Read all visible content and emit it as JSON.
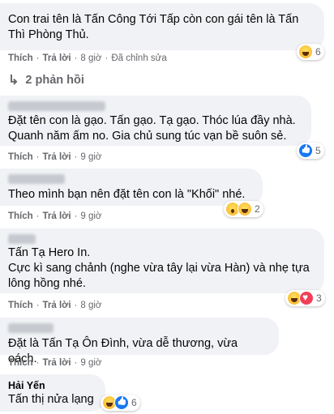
{
  "comments": [
    {
      "name": "",
      "text_lines": [
        "Con trai tên là Tấn Công Tới Tấp còn con gái tên là Tấn",
        "Thì Phòng Thủ."
      ],
      "actions": {
        "like": "Thích",
        "reply": "Trả lời",
        "time": "8 giờ",
        "edited": "Đã chỉnh sửa"
      },
      "reactions": {
        "icons": [
          "haha-icon"
        ],
        "count": "6"
      }
    },
    {
      "name": "",
      "text_lines": [
        "Đặt tên con là gạo. Tấn gạo. Tạ gạo. Thóc lúa đầy nhà.",
        "Quanh năm ấm no. Gia chủ sung túc vạn bề suôn sẻ."
      ],
      "actions": {
        "like": "Thích",
        "reply": "Trả lời",
        "time": "9 giờ"
      },
      "reactions": {
        "icons": [
          "like-icon"
        ],
        "count": "5"
      }
    },
    {
      "name": "",
      "text_lines": [
        "Theo mình bạn nên đặt tên con là \"Khối\" nhé."
      ],
      "actions": {
        "like": "Thích",
        "reply": "Trả lời",
        "time": "9 giờ"
      },
      "reactions": {
        "icons": [
          "wow-icon",
          "haha-icon"
        ],
        "count": "2"
      }
    },
    {
      "name": "",
      "text_lines": [
        "Tấn Tạ Hero In.",
        "Cực kì sang chảnh (nghe vừa tây lại vừa Hàn) và nhẹ tựa",
        "lông hồng nhé."
      ],
      "actions": {
        "like": "Thích",
        "reply": "Trả lời",
        "time": "8 giờ"
      },
      "reactions": {
        "icons": [
          "haha-icon",
          "love-icon"
        ],
        "count": "3"
      }
    },
    {
      "name": "",
      "text_lines": [
        "Đặt là Tấn Tạ Ôn Đình, vừa dễ thương, vừa oách."
      ],
      "actions": {
        "like": "Thích",
        "reply": "Trả lời",
        "time": "9 giờ"
      }
    },
    {
      "name": "Hải Yến",
      "text_lines": [
        "Tấn thị nửa lạng"
      ],
      "reactions": {
        "icons": [
          "haha-icon",
          "like-icon"
        ],
        "count": "6"
      }
    }
  ],
  "replies_link": {
    "label": "2 phản hồi"
  },
  "colors": {
    "bubble": "#f0f2f5",
    "meta": "#65676b",
    "like": "#1877f2",
    "love": "#f33e58"
  }
}
